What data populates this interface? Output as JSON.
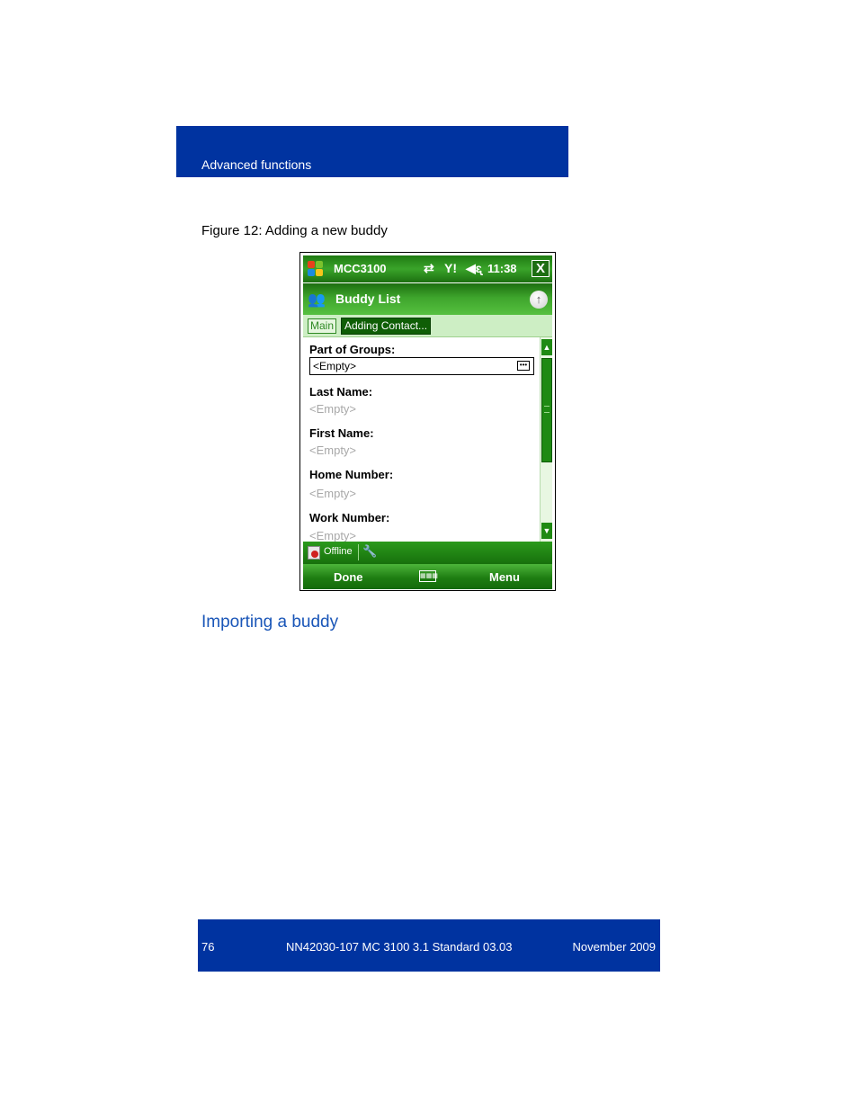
{
  "header": {
    "section": "Advanced functions"
  },
  "figure": {
    "caption": "Figure 12: Adding a new buddy"
  },
  "phone": {
    "status_bar": {
      "app_name": "MCC3100",
      "time": "11:38",
      "close_label": "X",
      "icons": [
        "windows-start-icon",
        "data-sync-icon",
        "signal-icon",
        "speaker-icon"
      ]
    },
    "title_bar": {
      "title": "Buddy List",
      "up_icon": "up-arrow-icon"
    },
    "tabs": {
      "main": "Main",
      "adding": "Adding Contact..."
    },
    "form": {
      "part_of_groups_label": "Part of Groups:",
      "part_of_groups_value": "<Empty>",
      "last_name_label": "Last Name:",
      "last_name_value": "<Empty>",
      "first_name_label": "First Name:",
      "first_name_value": "<Empty>",
      "home_number_label": "Home Number:",
      "home_number_value": "<Empty>",
      "work_number_label": "Work Number:",
      "work_number_value": "<Empty>"
    },
    "presence": {
      "status": "Offline"
    },
    "softkeys": {
      "left": "Done",
      "right": "Menu"
    },
    "colors": {
      "green_dark": "#17700c",
      "green_light": "#56c040",
      "tab_bg": "#cdeec4"
    }
  },
  "section_heading": "Importing a buddy",
  "footer": {
    "page_number": "76",
    "doc_id": "NN42030-107 MC 3100  3.1 Standard 03.03",
    "date": "November 2009"
  }
}
